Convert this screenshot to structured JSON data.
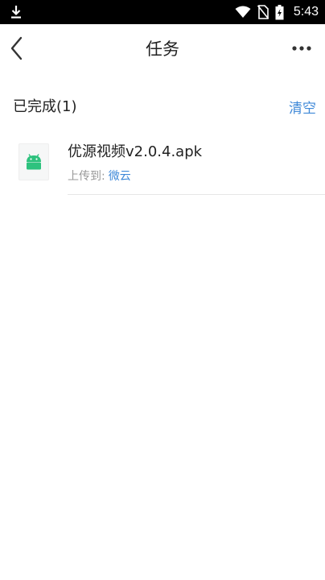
{
  "status_bar": {
    "time": "5:43",
    "icons": [
      "download-icon",
      "wifi-icon",
      "no-sim-icon",
      "battery-icon"
    ]
  },
  "title_bar": {
    "title": "任务",
    "back_icon": "chevron-left-icon",
    "more_icon": "more-dots-icon"
  },
  "section": {
    "title": "已完成(1)",
    "clear_label": "清空"
  },
  "tasks": [
    {
      "file_name": "优源视频v2.0.4.apk",
      "icon": "android-icon",
      "upload_label": "上传到:",
      "upload_target": "微云"
    }
  ],
  "colors": {
    "accent": "#3f89d8",
    "android_green": "#2ec27e",
    "status_bar": "#000000"
  }
}
